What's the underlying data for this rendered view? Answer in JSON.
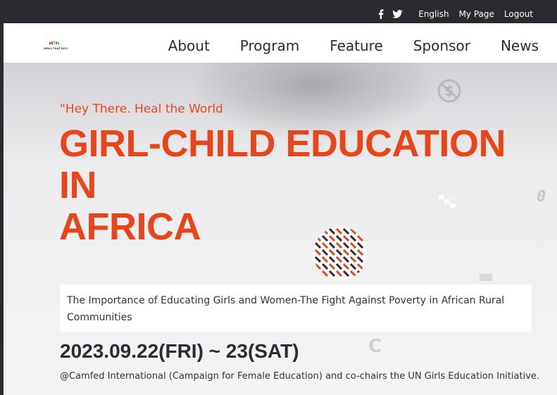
{
  "topbar": {
    "social": [
      "facebook-icon",
      "twitter-icon"
    ],
    "language": "English",
    "mypage": "My Page",
    "logout": "Logout"
  },
  "navbar": {
    "logo_text": "GIRLS THAT DO DICE",
    "items": [
      "About",
      "Program",
      "Feature",
      "Sponsor",
      "News"
    ]
  },
  "hero": {
    "slogan": "\"Hey There. Heal the World",
    "headline": [
      "GIRL-CHILD EDUCATION",
      "IN",
      "AFRICA"
    ],
    "subtitle": "The Importance of Educating Girls and Women-The Fight Against Poverty in African Rural Communities",
    "date": "2023.09.22(FRI) ~ 23(SAT)",
    "organizer": "@Camfed International (Campaign for Female Education) and co-chairs the UN Girls Education Initiative."
  },
  "colors": {
    "accent": "#e8461a",
    "dark": "#2a2b30",
    "text": "#2b2b33"
  }
}
